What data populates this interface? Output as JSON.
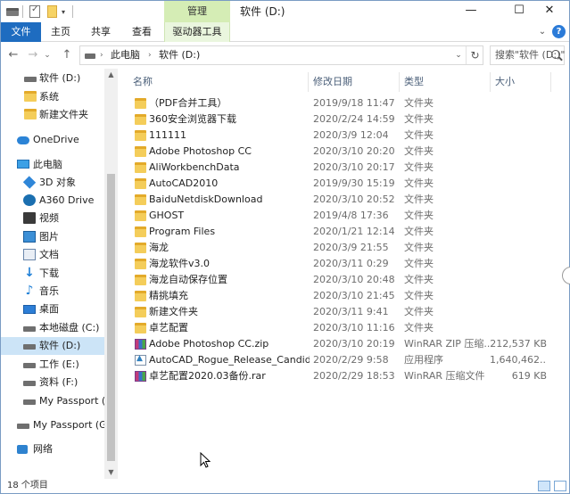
{
  "title": {
    "manage_tab": "管理",
    "window_title": "软件 (D:)",
    "minimize": "—",
    "maximize": "☐",
    "close": "✕"
  },
  "ribbon": {
    "tabs": [
      "文件",
      "主页",
      "共享",
      "查看",
      "驱动器工具"
    ],
    "expand": "⌄",
    "help": "?"
  },
  "nav": {
    "back": "←",
    "forward": "→",
    "recent": "⌄",
    "up": "↑",
    "breadcrumb": [
      "此电脑",
      "软件 (D:)"
    ],
    "crumb_sep": "›",
    "addr_drop": "⌄",
    "refresh": "↻",
    "search_placeholder": "搜索\"软件 (D:)\""
  },
  "sidebar": {
    "items": [
      {
        "label": "软件 (D:)",
        "icon": "drive-icon",
        "selected": false
      },
      {
        "label": "系统",
        "icon": "folder-icon",
        "selected": false
      },
      {
        "label": "新建文件夹",
        "icon": "folder-icon",
        "selected": false
      },
      {
        "label": "OneDrive",
        "icon": "onedrive-icon",
        "selected": false
      },
      {
        "label": "此电脑",
        "icon": "computer-icon",
        "selected": false
      },
      {
        "label": "3D 对象",
        "icon": "3d-objects-icon",
        "selected": false
      },
      {
        "label": "A360 Drive",
        "icon": "a360-icon",
        "selected": false
      },
      {
        "label": "视频",
        "icon": "video-icon",
        "selected": false
      },
      {
        "label": "图片",
        "icon": "pictures-icon",
        "selected": false
      },
      {
        "label": "文档",
        "icon": "documents-icon",
        "selected": false
      },
      {
        "label": "下载",
        "icon": "downloads-icon",
        "selected": false
      },
      {
        "label": "音乐",
        "icon": "music-icon",
        "selected": false
      },
      {
        "label": "桌面",
        "icon": "desktop-icon",
        "selected": false
      },
      {
        "label": "本地磁盘 (C:)",
        "icon": "drive-icon",
        "selected": false
      },
      {
        "label": "软件 (D:)",
        "icon": "drive-icon",
        "selected": true
      },
      {
        "label": "工作 (E:)",
        "icon": "drive-icon",
        "selected": false
      },
      {
        "label": "资料 (F:)",
        "icon": "drive-icon",
        "selected": false
      },
      {
        "label": "My Passport (G:)",
        "icon": "drive-icon",
        "selected": false
      },
      {
        "label": "My Passport (G:)",
        "icon": "drive-icon",
        "selected": false
      },
      {
        "label": "网络",
        "icon": "network-icon",
        "selected": false
      }
    ],
    "scroll_up": "▲",
    "scroll_down": "▼"
  },
  "columns": {
    "name": "名称",
    "date": "修改日期",
    "type": "类型",
    "size": "大小",
    "sort_indicator": "^"
  },
  "files": [
    {
      "name": "（PDF合并工具）",
      "date": "2019/9/18 11:47",
      "type": "文件夹",
      "size": "",
      "kind": "folder"
    },
    {
      "name": "360安全浏览器下载",
      "date": "2020/2/24 14:59",
      "type": "文件夹",
      "size": "",
      "kind": "folder"
    },
    {
      "name": "111111",
      "date": "2020/3/9 12:04",
      "type": "文件夹",
      "size": "",
      "kind": "folder"
    },
    {
      "name": "Adobe Photoshop CC",
      "date": "2020/3/10 20:20",
      "type": "文件夹",
      "size": "",
      "kind": "folder"
    },
    {
      "name": "AliWorkbenchData",
      "date": "2020/3/10 20:17",
      "type": "文件夹",
      "size": "",
      "kind": "folder"
    },
    {
      "name": "AutoCAD2010",
      "date": "2019/9/30 15:19",
      "type": "文件夹",
      "size": "",
      "kind": "folder"
    },
    {
      "name": "BaiduNetdiskDownload",
      "date": "2020/3/10 20:52",
      "type": "文件夹",
      "size": "",
      "kind": "folder"
    },
    {
      "name": "GHOST",
      "date": "2019/4/8 17:36",
      "type": "文件夹",
      "size": "",
      "kind": "folder"
    },
    {
      "name": "Program Files",
      "date": "2020/1/21 12:14",
      "type": "文件夹",
      "size": "",
      "kind": "folder"
    },
    {
      "name": "海龙",
      "date": "2020/3/9 21:55",
      "type": "文件夹",
      "size": "",
      "kind": "folder"
    },
    {
      "name": "海龙软件v3.0",
      "date": "2020/3/11 0:29",
      "type": "文件夹",
      "size": "",
      "kind": "folder"
    },
    {
      "name": "海龙自动保存位置",
      "date": "2020/3/10 20:48",
      "type": "文件夹",
      "size": "",
      "kind": "folder"
    },
    {
      "name": "精挑填充",
      "date": "2020/3/10 21:45",
      "type": "文件夹",
      "size": "",
      "kind": "folder"
    },
    {
      "name": "新建文件夹",
      "date": "2020/3/11 9:41",
      "type": "文件夹",
      "size": "",
      "kind": "folder"
    },
    {
      "name": "卓艺配置",
      "date": "2020/3/10 11:16",
      "type": "文件夹",
      "size": "",
      "kind": "folder"
    },
    {
      "name": "Adobe Photoshop CC.zip",
      "date": "2020/3/10 20:19",
      "type": "WinRAR ZIP 压缩...",
      "size": "212,537 KB",
      "kind": "zip"
    },
    {
      "name": "AutoCAD_Rogue_Release_Candid...",
      "date": "2020/2/29 9:58",
      "type": "应用程序",
      "size": "1,640,462...",
      "kind": "exe"
    },
    {
      "name": "卓艺配置2020.03备份.rar",
      "date": "2020/2/29 18:53",
      "type": "WinRAR 压缩文件",
      "size": "619 KB",
      "kind": "zip"
    }
  ],
  "status": {
    "item_count": "18 个项目"
  }
}
